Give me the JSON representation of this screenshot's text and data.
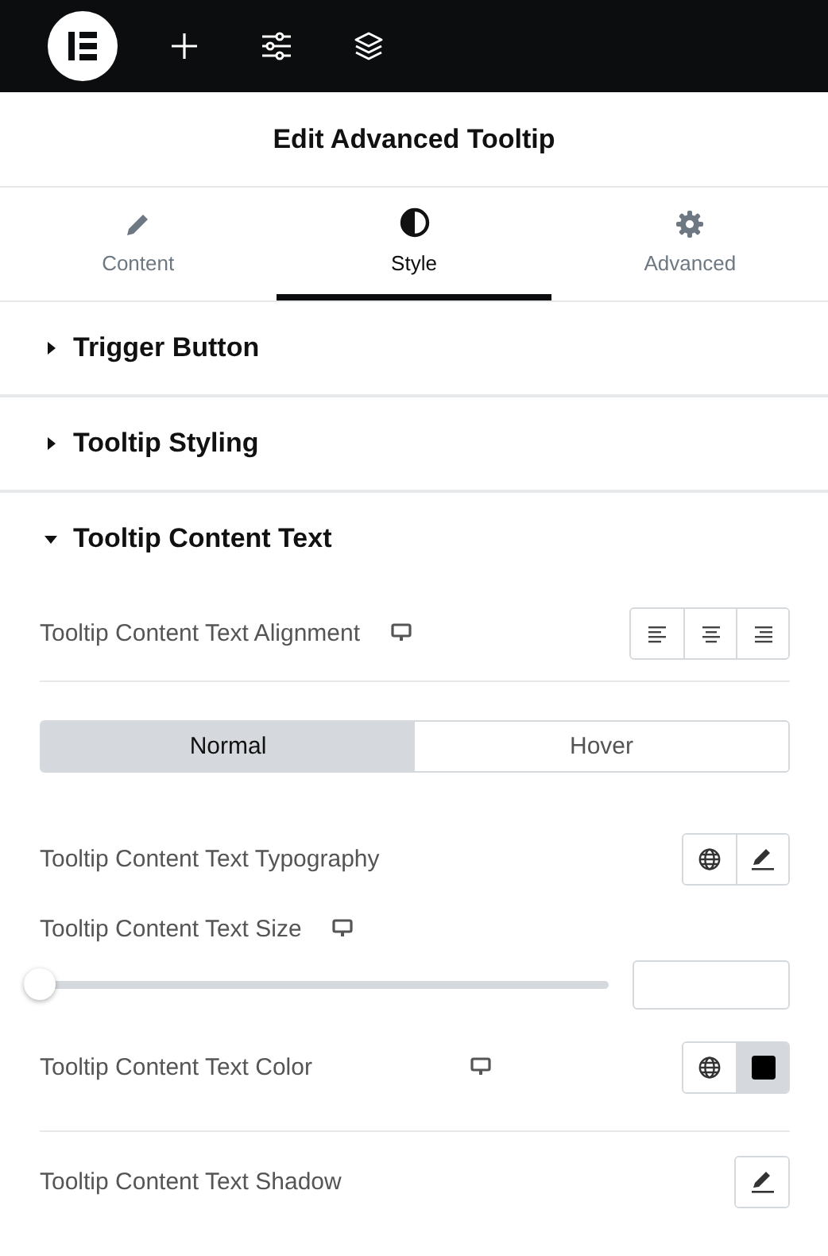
{
  "panel_title": "Edit Advanced Tooltip",
  "tabs": [
    {
      "label": "Content",
      "selected": false
    },
    {
      "label": "Style",
      "selected": true
    },
    {
      "label": "Advanced",
      "selected": false
    }
  ],
  "sections": [
    {
      "title": "Trigger Button",
      "expanded": false
    },
    {
      "title": "Tooltip Styling",
      "expanded": false
    },
    {
      "title": "Tooltip Content Text",
      "expanded": true
    }
  ],
  "controls": [
    {
      "kind": "alignment",
      "label": "Tooltip Content Text Alignment",
      "responsive": true,
      "divider_after": true
    },
    {
      "kind": "state_tabs",
      "options": [
        {
          "label": "Normal",
          "selected": true
        },
        {
          "label": "Hover",
          "selected": false
        }
      ]
    },
    {
      "kind": "popover",
      "label": "Tooltip Content Text Typography",
      "global": true
    },
    {
      "kind": "slider",
      "label": "Tooltip Content Text Size",
      "responsive": true,
      "level": 0
    },
    {
      "kind": "color",
      "label": "Tooltip Content Text Color",
      "responsive": true,
      "color": "#000000",
      "divider_after": true
    },
    {
      "kind": "popover",
      "label": "Tooltip Content Text Shadow",
      "global": false
    }
  ]
}
